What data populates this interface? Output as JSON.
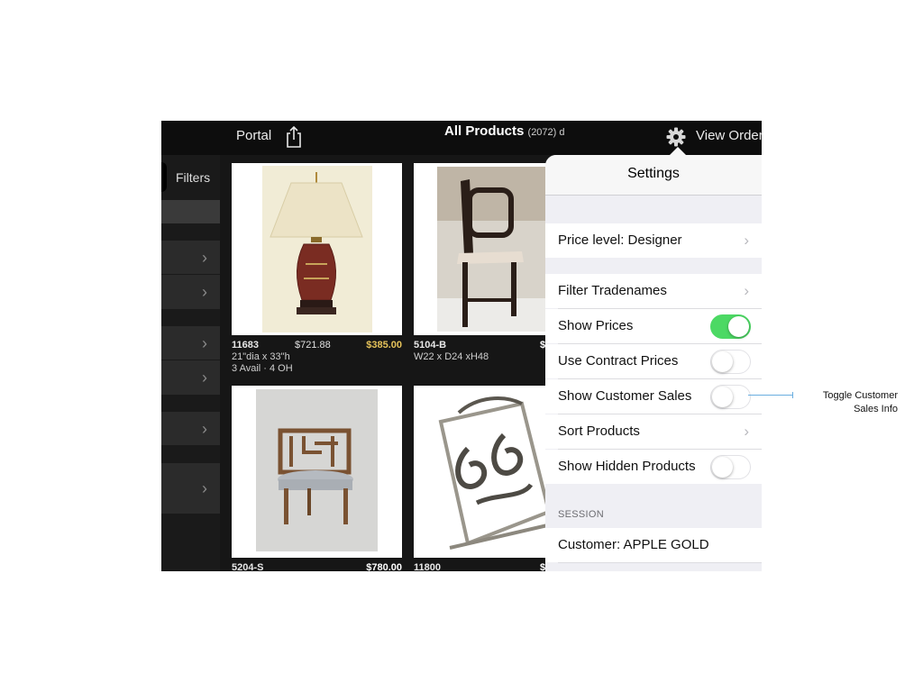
{
  "topbar": {
    "portal_label": "Portal",
    "title": "All Products",
    "count": "(2072) d",
    "view_order_label": "View Order"
  },
  "sidebar": {
    "filters_label": "Filters"
  },
  "products": [
    {
      "sku": "11683",
      "price1": "$721.88",
      "price2": "$385.00",
      "line2": "21\"dia x 33\"h",
      "line3": "3 Avail · 4 OH"
    },
    {
      "sku": "5104-B",
      "price1": "$",
      "line2": "W22 x D24 xH48"
    },
    {
      "sku": "5204-S",
      "price2": "$780.00"
    },
    {
      "sku": "11800",
      "price1": "$"
    }
  ],
  "settings": {
    "title": "Settings",
    "price_level": "Price level: Designer",
    "filter_tradenames": "Filter Tradenames",
    "show_prices": "Show Prices",
    "show_prices_on": true,
    "use_contract_prices": "Use Contract Prices",
    "use_contract_prices_on": false,
    "show_customer_sales": "Show Customer Sales",
    "show_customer_sales_on": false,
    "sort_products": "Sort Products",
    "show_hidden_products": "Show Hidden Products",
    "show_hidden_products_on": false,
    "session_header": "SESSION",
    "customer": "Customer: APPLE GOLD"
  },
  "annotation": {
    "line1": "Toggle Customer",
    "line2": "Sales Info"
  },
  "colors": {
    "toggle_on": "#4cd964",
    "price_gold": "#e6c35a",
    "callout_line": "#6aaee0"
  },
  "icons": [
    "share-icon",
    "gear-icon",
    "chevron-right-icon"
  ]
}
